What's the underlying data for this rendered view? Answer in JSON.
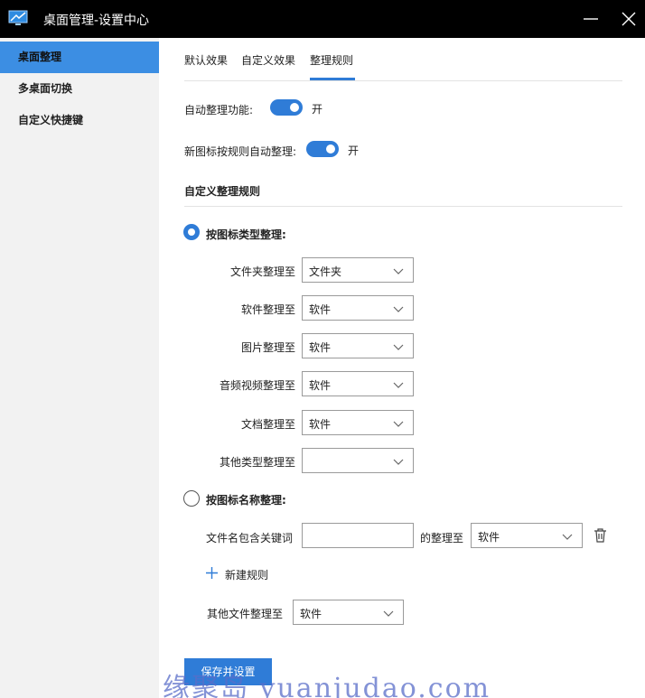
{
  "window": {
    "title": "桌面管理-设置中心",
    "app_icon": "desktop-monitor-icon",
    "minimize_icon": "minimize-icon",
    "close_icon": "close-icon"
  },
  "sidebar": {
    "items": [
      {
        "label": "桌面整理",
        "active": true
      },
      {
        "label": "多桌面切换",
        "active": false
      },
      {
        "label": "自定义快捷键",
        "active": false
      }
    ]
  },
  "tabs": [
    {
      "label": "默认效果",
      "active": false
    },
    {
      "label": "自定义效果",
      "active": false
    },
    {
      "label": "整理规则",
      "active": true
    }
  ],
  "settings": {
    "auto_organize": {
      "label": "自动整理功能:",
      "state": "开",
      "on": true
    },
    "new_icon_auto": {
      "label": "新图标按规则自动整理:",
      "state": "开",
      "on": true
    }
  },
  "custom_rules": {
    "heading": "自定义整理规则",
    "by_type": {
      "label": "按图标类型整理:",
      "selected": true,
      "rows": [
        {
          "label": "文件夹整理至",
          "value": "文件夹"
        },
        {
          "label": "软件整理至",
          "value": "软件"
        },
        {
          "label": "图片整理至",
          "value": "软件"
        },
        {
          "label": "音频视频整理至",
          "value": "软件"
        },
        {
          "label": "文档整理至",
          "value": "软件"
        },
        {
          "label": "其他类型整理至",
          "value": ""
        }
      ]
    },
    "by_name": {
      "label": "按图标名称整理:",
      "selected": false,
      "keyword_label": "文件名包含关键词",
      "keyword_value": "",
      "target_label": "的整理至",
      "target_value": "软件",
      "delete_icon": "trash-icon",
      "add_rule_label": "新建规则",
      "add_icon": "plus-icon",
      "other_label": "其他文件整理至",
      "other_value": "软件"
    }
  },
  "footer": {
    "save_label": "保存并设置"
  },
  "watermark": {
    "text": "缘聚岛 yuanjudao.com"
  },
  "colors": {
    "accent": "#2f7cd7",
    "sidebar_active": "#3c8ee3",
    "titlebar": "#000000",
    "sidebar_bg": "#f2f2f2"
  }
}
